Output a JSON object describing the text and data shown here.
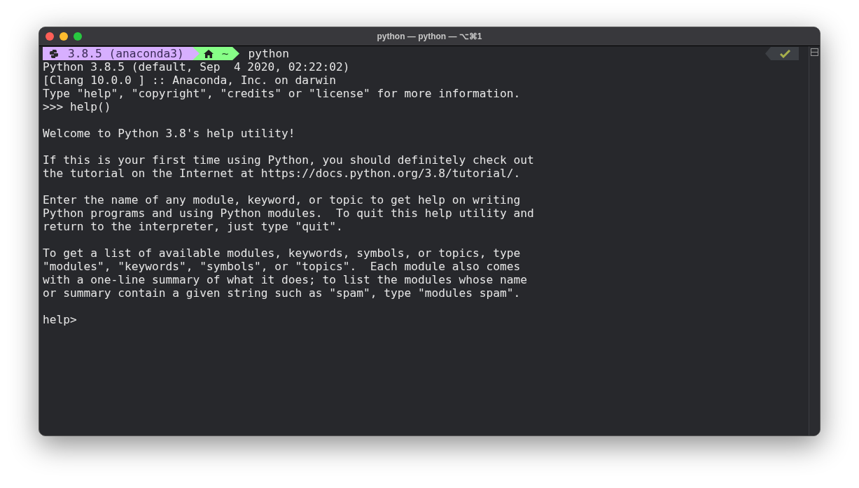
{
  "window": {
    "title": "python — python — ⌥⌘1"
  },
  "prompt": {
    "env_segment": "3.8.5 (anaconda3)",
    "dir_segment": "~",
    "command": "python",
    "last_status_ok": true
  },
  "output_blocks": [
    [
      "Python 3.8.5 (default, Sep  4 2020, 02:22:02)",
      "[Clang 10.0.0 ] :: Anaconda, Inc. on darwin",
      "Type \"help\", \"copyright\", \"credits\" or \"license\" for more information.",
      ">>> help()"
    ],
    [
      "Welcome to Python 3.8's help utility!"
    ],
    [
      "If this is your first time using Python, you should definitely check out",
      "the tutorial on the Internet at https://docs.python.org/3.8/tutorial/."
    ],
    [
      "Enter the name of any module, keyword, or topic to get help on writing",
      "Python programs and using Python modules.  To quit this help utility and",
      "return to the interpreter, just type \"quit\"."
    ],
    [
      "To get a list of available modules, keywords, symbols, or topics, type",
      "\"modules\", \"keywords\", \"symbols\", or \"topics\".  Each module also comes",
      "with a one-line summary of what it does; to list the modules whose name",
      "or summary contain a given string such as \"spam\", type \"modules spam\"."
    ],
    [
      "help>"
    ]
  ]
}
